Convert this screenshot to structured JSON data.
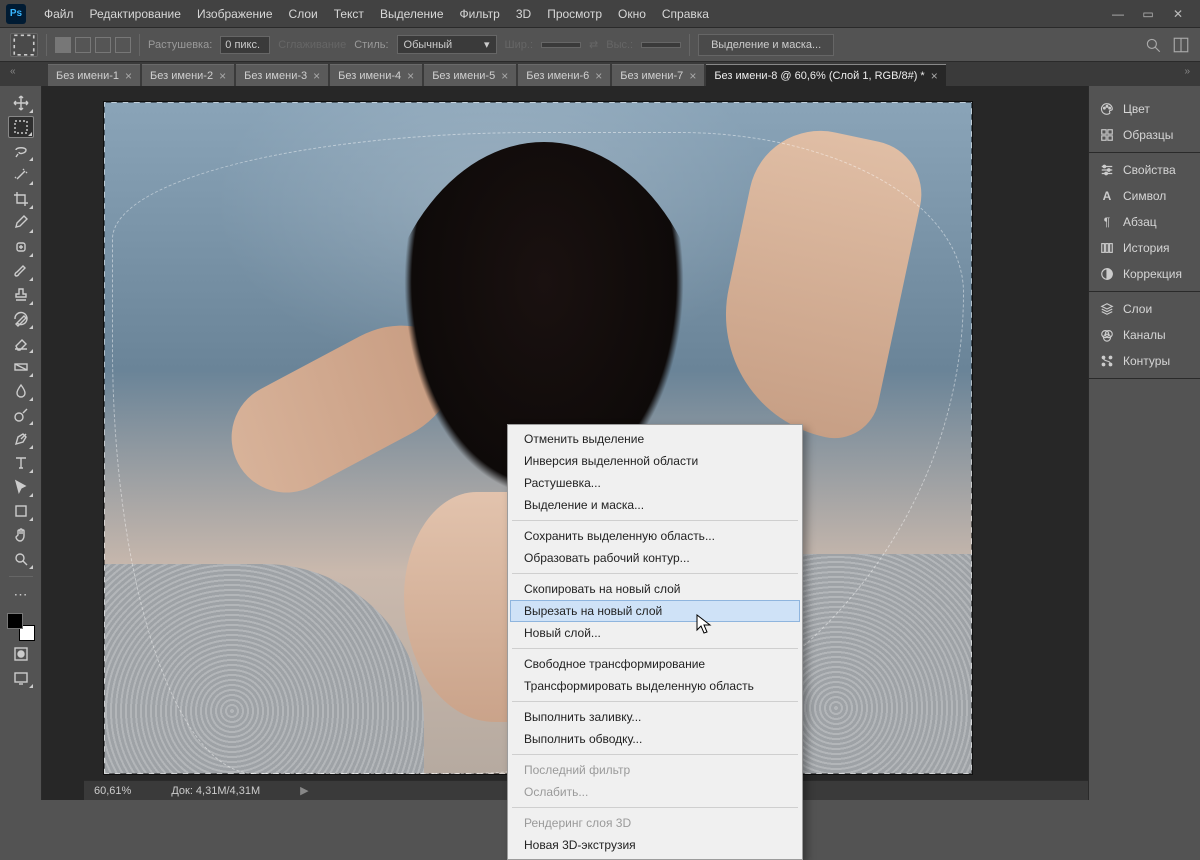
{
  "menubar": {
    "items": [
      "Файл",
      "Редактирование",
      "Изображение",
      "Слои",
      "Текст",
      "Выделение",
      "Фильтр",
      "3D",
      "Просмотр",
      "Окно",
      "Справка"
    ]
  },
  "optbar": {
    "feather_label": "Растушевка:",
    "feather_value": "0 пикс.",
    "antialias": "Сглаживание",
    "style_label": "Стиль:",
    "style_value": "Обычный",
    "width_label": "Шир.:",
    "height_label": "Выс.:",
    "select_mask_btn": "Выделение и маска..."
  },
  "tabs": {
    "items": [
      {
        "label": "Без имени-1",
        "active": false
      },
      {
        "label": "Без имени-2",
        "active": false
      },
      {
        "label": "Без имени-3",
        "active": false
      },
      {
        "label": "Без имени-4",
        "active": false
      },
      {
        "label": "Без имени-5",
        "active": false
      },
      {
        "label": "Без имени-6",
        "active": false
      },
      {
        "label": "Без имени-7",
        "active": false
      },
      {
        "label": "Без имени-8 @ 60,6% (Слой 1, RGB/8#) *",
        "active": true
      }
    ]
  },
  "status": {
    "zoom": "60,61%",
    "doc": "Док: 4,31M/4,31M"
  },
  "panels": {
    "group1": [
      {
        "icon": "palette",
        "label": "Цвет"
      },
      {
        "icon": "grid",
        "label": "Образцы"
      }
    ],
    "group2": [
      {
        "icon": "sliders",
        "label": "Свойства"
      },
      {
        "icon": "A",
        "label": "Символ"
      },
      {
        "icon": "paragraph",
        "label": "Абзац"
      },
      {
        "icon": "clock",
        "label": "История"
      },
      {
        "icon": "circle",
        "label": "Коррекция"
      }
    ],
    "group3": [
      {
        "icon": "layers",
        "label": "Слои"
      },
      {
        "icon": "channels",
        "label": "Каналы"
      },
      {
        "icon": "paths",
        "label": "Контуры"
      }
    ]
  },
  "context_menu": {
    "groups": [
      [
        {
          "label": "Отменить выделение",
          "enabled": true
        },
        {
          "label": "Инверсия выделенной области",
          "enabled": true
        },
        {
          "label": "Растушевка...",
          "enabled": true
        },
        {
          "label": "Выделение и маска...",
          "enabled": true
        }
      ],
      [
        {
          "label": "Сохранить выделенную область...",
          "enabled": true
        },
        {
          "label": "Образовать рабочий контур...",
          "enabled": true
        }
      ],
      [
        {
          "label": "Скопировать на новый слой",
          "enabled": true
        },
        {
          "label": "Вырезать на новый слой",
          "enabled": true,
          "hover": true
        },
        {
          "label": "Новый слой...",
          "enabled": true
        }
      ],
      [
        {
          "label": "Свободное трансформирование",
          "enabled": true
        },
        {
          "label": "Трансформировать выделенную область",
          "enabled": true
        }
      ],
      [
        {
          "label": "Выполнить заливку...",
          "enabled": true
        },
        {
          "label": "Выполнить обводку...",
          "enabled": true
        }
      ],
      [
        {
          "label": "Последний фильтр",
          "enabled": false
        },
        {
          "label": "Ослабить...",
          "enabled": false
        }
      ],
      [
        {
          "label": "Рендеринг слоя 3D",
          "enabled": false
        },
        {
          "label": "Новая 3D-экструзия",
          "enabled": true
        }
      ]
    ]
  }
}
